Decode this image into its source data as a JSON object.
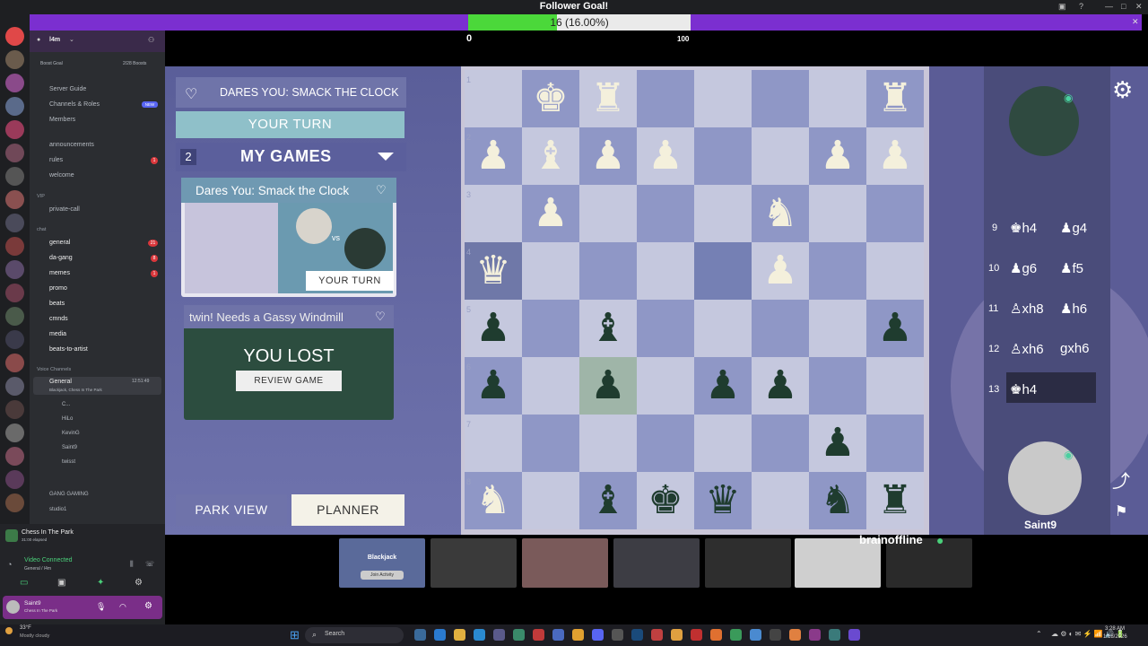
{
  "goal": {
    "title": "Follower Goal!",
    "progress_text": "16 (16.00%)",
    "progress": 0.16,
    "min": "0",
    "max": "100"
  },
  "discord": {
    "server_name": "l4m",
    "boost_goal": "Boost Goal",
    "boost_count": "2/28 Boosts",
    "menu": [
      {
        "label": "Server Guide"
      },
      {
        "label": "Channels & Roles",
        "badge": "NEW"
      },
      {
        "label": "Members"
      }
    ],
    "channels_top": [
      {
        "label": "announcements"
      },
      {
        "label": "rules",
        "badge": "1"
      },
      {
        "label": "welcome"
      }
    ],
    "vip_cat": "VIP",
    "vip_channel": "private-call",
    "chat_cat": "chat",
    "chat_channels": [
      {
        "label": "general",
        "badge": "21"
      },
      {
        "label": "da-gang",
        "badge": "8"
      },
      {
        "label": "memes",
        "badge": "1"
      },
      {
        "label": "promo"
      },
      {
        "label": "beats"
      },
      {
        "label": "cmnds"
      },
      {
        "label": "media"
      },
      {
        "label": "beats-to-artist"
      }
    ],
    "voice_cat": "Voice Channels",
    "voice_channel": "General",
    "voice_timer": "12:51:49",
    "voice_activity": "Blackjack, Chess In The Park",
    "voice_users": [
      "C...",
      "HiLo",
      "KevinG",
      "Saint9",
      "twisst",
      ""
    ],
    "gang_gaming": "GANG GAMING",
    "studio": "studio1",
    "activity_title": "Chess In The Park",
    "activity_sub": "31:00 elapsed",
    "video_connected": "Video Connected",
    "video_sub": "General / l4m",
    "user_name": "Saint9",
    "user_status": "Chess In The Park",
    "weather_temp": "33°F",
    "weather_desc": "Mostly cloudy"
  },
  "taskbar": {
    "search_placeholder": "Search",
    "time": "3:28 AM",
    "date": "1/18/2026"
  },
  "game": {
    "dares_title": "DARES YOU: SMACK THE CLOCK",
    "your_turn": "YOUR TURN",
    "my_games_count": "2",
    "my_games_label": "MY GAMES",
    "card1_title": "Dares You: Smack the Clock",
    "card1_vs": "vs",
    "card1_button": "YOUR TURN",
    "card2_title": "twin! Needs a Gassy Windmill",
    "card2_result": "YOU LOST",
    "card2_button": "REVIEW GAME",
    "park_view": "PARK VIEW",
    "planner": "PLANNER",
    "ranks": [
      "1",
      "2",
      "3",
      "4",
      "5",
      "6",
      "7",
      "8"
    ],
    "moves": [
      {
        "n": "9",
        "w": "♚h4",
        "b": "♟g4"
      },
      {
        "n": "10",
        "w": "♟g6",
        "b": "♟f5"
      },
      {
        "n": "11",
        "w": "♙xh8",
        "b": "♟h6"
      },
      {
        "n": "12",
        "w": "♙xh6",
        "b": "gxh6"
      },
      {
        "n": "13",
        "w": "♚h4",
        "b": ""
      }
    ],
    "player_name": "Saint9"
  },
  "stream": {
    "blackjack_label": "Blackjack",
    "join_activity": "Join Activity",
    "brain_name": "brainoffline"
  }
}
